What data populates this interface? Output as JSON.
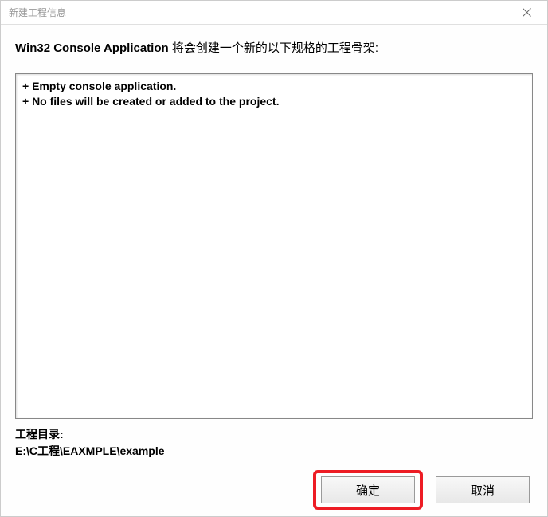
{
  "titlebar": {
    "title": "新建工程信息"
  },
  "heading": {
    "prefix_bold": "Win32 Console Application",
    "suffix": " 将会创建一个新的以下规格的工程骨架:"
  },
  "info_lines": {
    "line1": "+ Empty console application.",
    "line2": "+ No files will be created or added to the project."
  },
  "project_dir": {
    "label": "工程目录:",
    "path": "E:\\C工程\\EAXMPLE\\example"
  },
  "buttons": {
    "ok": "确定",
    "cancel": "取消"
  }
}
